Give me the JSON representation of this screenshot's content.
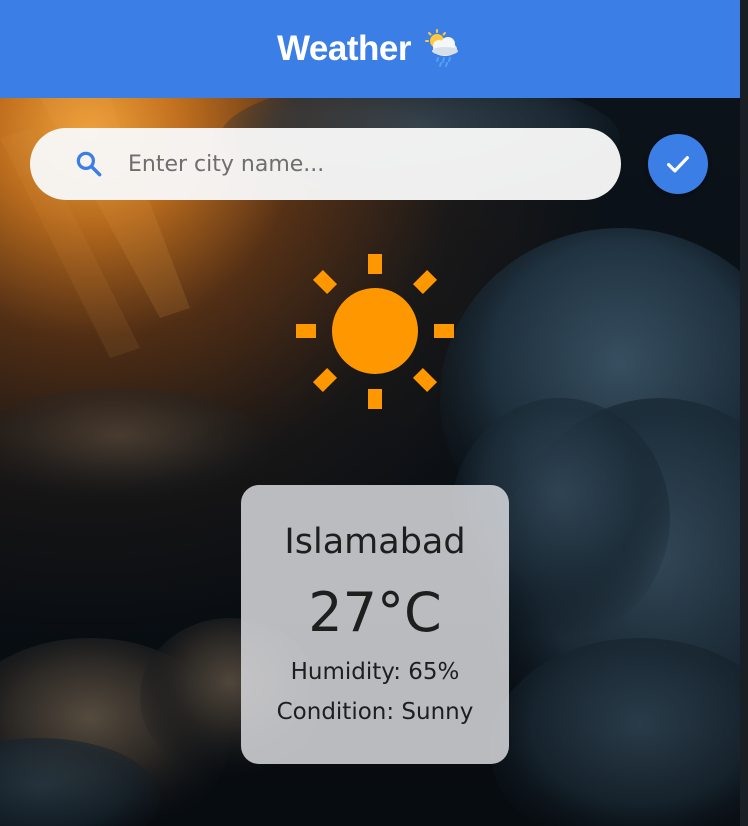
{
  "app_bar": {
    "title": "Weather",
    "title_icon": "sun-behind-rain-cloud-icon",
    "background_color": "#3b7ee6"
  },
  "search": {
    "placeholder": "Enter city name...",
    "value": "",
    "icon": "search-icon",
    "submit_icon": "check-icon",
    "accent_color": "#3b7ee6"
  },
  "weather": {
    "icon": "sun-icon",
    "icon_color": "#ff9800",
    "city": "Islamabad",
    "temperature": "27°C",
    "humidity": "Humidity: 65%",
    "condition": "Condition: Sunny"
  },
  "background": {
    "description_icon": "cloudy-sky-background"
  }
}
